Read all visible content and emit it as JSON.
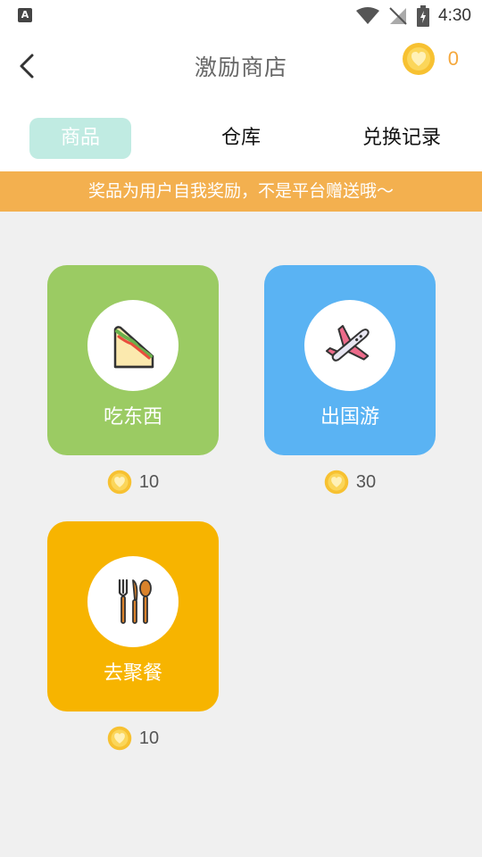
{
  "status_bar": {
    "time": "4:30",
    "sim_letter": "A"
  },
  "header": {
    "title": "激励商店",
    "coin_count": "0"
  },
  "tabs": [
    {
      "label": "商品",
      "active": true
    },
    {
      "label": "仓库",
      "active": false
    },
    {
      "label": "兑换记录",
      "active": false
    }
  ],
  "banner": {
    "text": "奖品为用户自我奖励，不是平台赠送哦～"
  },
  "products": [
    {
      "name": "吃东西",
      "price": "10",
      "icon": "sandwich-icon",
      "color": "#9bcb63"
    },
    {
      "name": "出国游",
      "price": "30",
      "icon": "airplane-icon",
      "color": "#5ab3f3"
    },
    {
      "name": "去聚餐",
      "price": "10",
      "icon": "utensils-icon",
      "color": "#f7b400"
    }
  ],
  "colors": {
    "coin": "#f7c131",
    "accent": "#f5a83c",
    "tab_active": "#c0ebe2",
    "banner": "#f3b04f"
  }
}
